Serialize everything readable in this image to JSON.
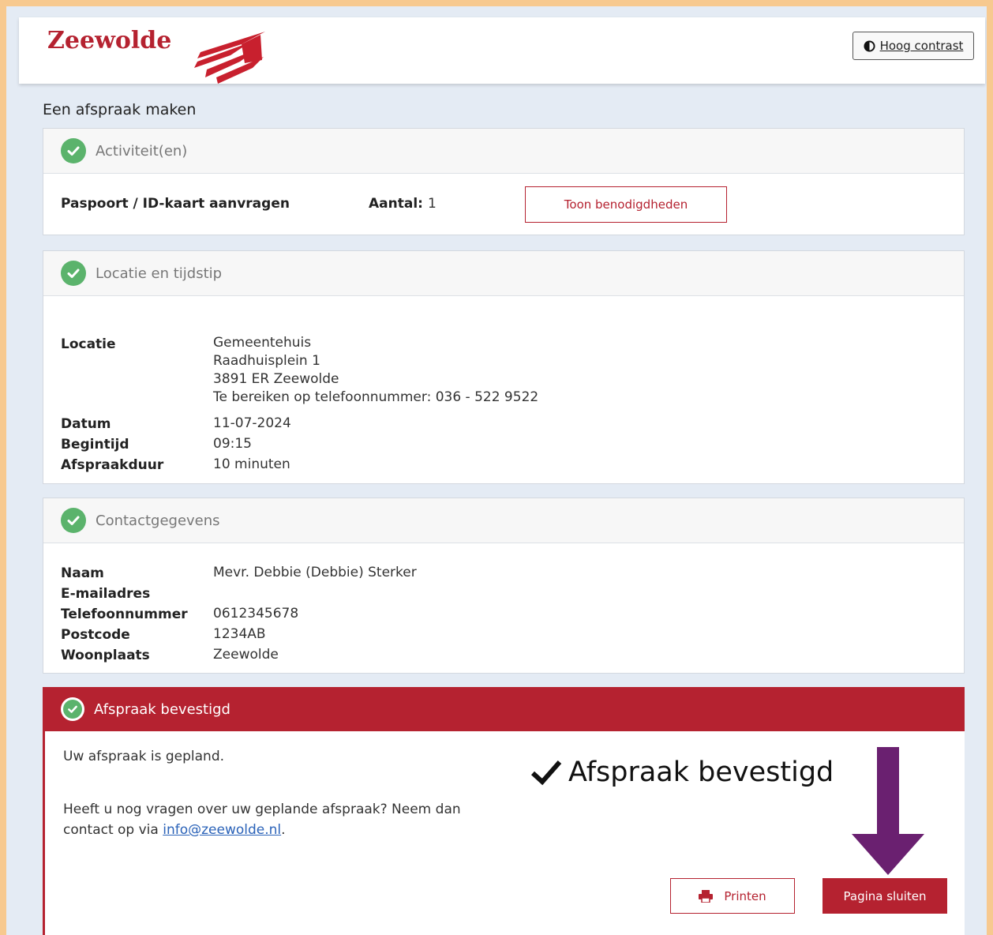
{
  "header": {
    "logo_text": "Zeewolde",
    "contrast_label": "Hoog contrast"
  },
  "page_title": "Een afspraak maken",
  "activities": {
    "title": "Activiteit(en)",
    "item": "Paspoort / ID-kaart aanvragen",
    "count_label": "Aantal:",
    "count_value": "1",
    "button": "Toon benodigdheden"
  },
  "location": {
    "title": "Locatie en tijdstip",
    "locatie_label": "Locatie",
    "address_lines": [
      "Gemeentehuis",
      "Raadhuisplein 1",
      "3891 ER Zeewolde",
      "Te bereiken op telefoonnummer: 036 - 522 9522"
    ],
    "datum_label": "Datum",
    "datum_value": "11-07-2024",
    "begintijd_label": "Begintijd",
    "begintijd_value": "09:15",
    "duur_label": "Afspraakduur",
    "duur_value": "10 minuten"
  },
  "contact": {
    "title": "Contactgegevens",
    "naam_label": "Naam",
    "naam_value": "Mevr. Debbie (Debbie) Sterker",
    "email_label": "E-mailadres",
    "email_value": "",
    "telefoon_label": "Telefoonnummer",
    "telefoon_value": "0612345678",
    "postcode_label": "Postcode",
    "postcode_value": "1234AB",
    "woonplaats_label": "Woonplaats",
    "woonplaats_value": "Zeewolde"
  },
  "confirmation": {
    "title": "Afspraak bevestigd",
    "planned_text": "Uw afspraak is gepland.",
    "question_text_1": "Heeft u nog vragen over uw geplande afspraak? Neem dan",
    "question_text_2": "contact op via",
    "email_link": "info@zeewolde.nl",
    "period": ".",
    "big_label": "Afspraak bevestigd",
    "print_button": "Printen",
    "close_button": "Pagina sluiten"
  },
  "colors": {
    "brand_red": "#b52230",
    "check_green": "#5bb36c",
    "arrow_purple": "#6a2070"
  }
}
